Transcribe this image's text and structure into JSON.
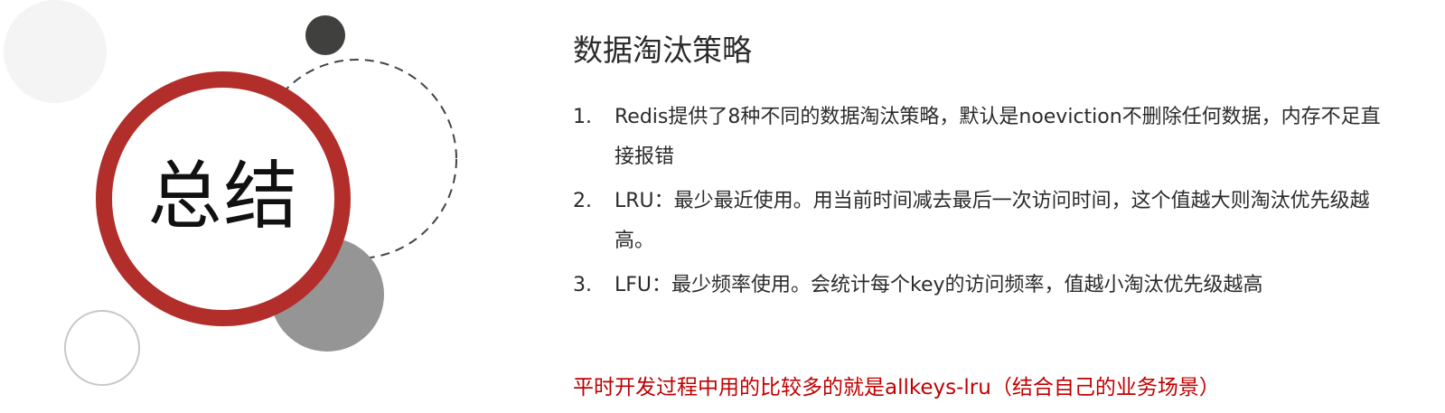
{
  "colors": {
    "accent": "#c00000",
    "ring": "#b12e2b",
    "dark_circle": "#40413f",
    "gray_circle": "#959595",
    "light_circle": "#f4f4f4",
    "text": "#2b2b2b"
  },
  "slide": {
    "summary_label": "总结",
    "title": "数据淘汰策略",
    "points": [
      {
        "number": "1.",
        "text": "Redis提供了8种不同的数据淘汰策略，默认是noeviction不删除任何数据，内存不足直接报错"
      },
      {
        "number": "2.",
        "text": "LRU：最少最近使用。用当前时间减去最后一次访问时间，这个值越大则淘汰优先级越高。"
      },
      {
        "number": "3.",
        "text": "LFU：最少频率使用。会统计每个key的访问频率，值越小淘汰优先级越高"
      }
    ],
    "note": "平时开发过程中用的比较多的就是allkeys-lru（结合自己的业务场景）"
  }
}
